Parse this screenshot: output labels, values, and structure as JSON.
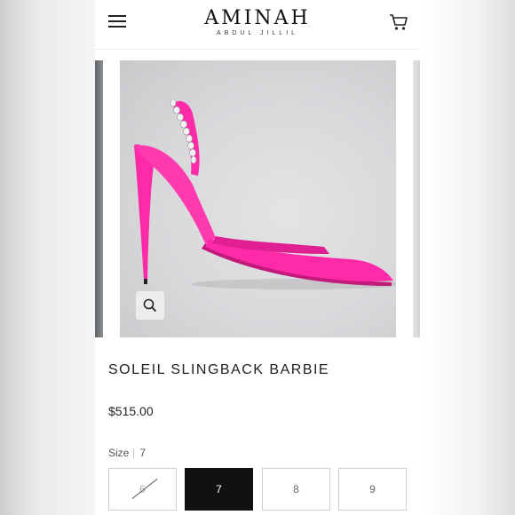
{
  "brand": {
    "name": "AMINAH",
    "tagline": "ABDUL JILLIL"
  },
  "header": {
    "menu_icon": "hamburger-menu-icon",
    "cart_icon": "shopping-cart-icon"
  },
  "gallery": {
    "zoom_icon": "magnifier-icon",
    "product_color": "#ff2aa8"
  },
  "product": {
    "title": "SOLEIL SLINGBACK BARBIE",
    "price": "$515.00"
  },
  "size_selector": {
    "label": "Size",
    "selected": "7",
    "options": [
      {
        "label": "6",
        "available": false
      },
      {
        "label": "7",
        "available": true
      },
      {
        "label": "8",
        "available": true
      },
      {
        "label": "9",
        "available": true
      }
    ]
  }
}
